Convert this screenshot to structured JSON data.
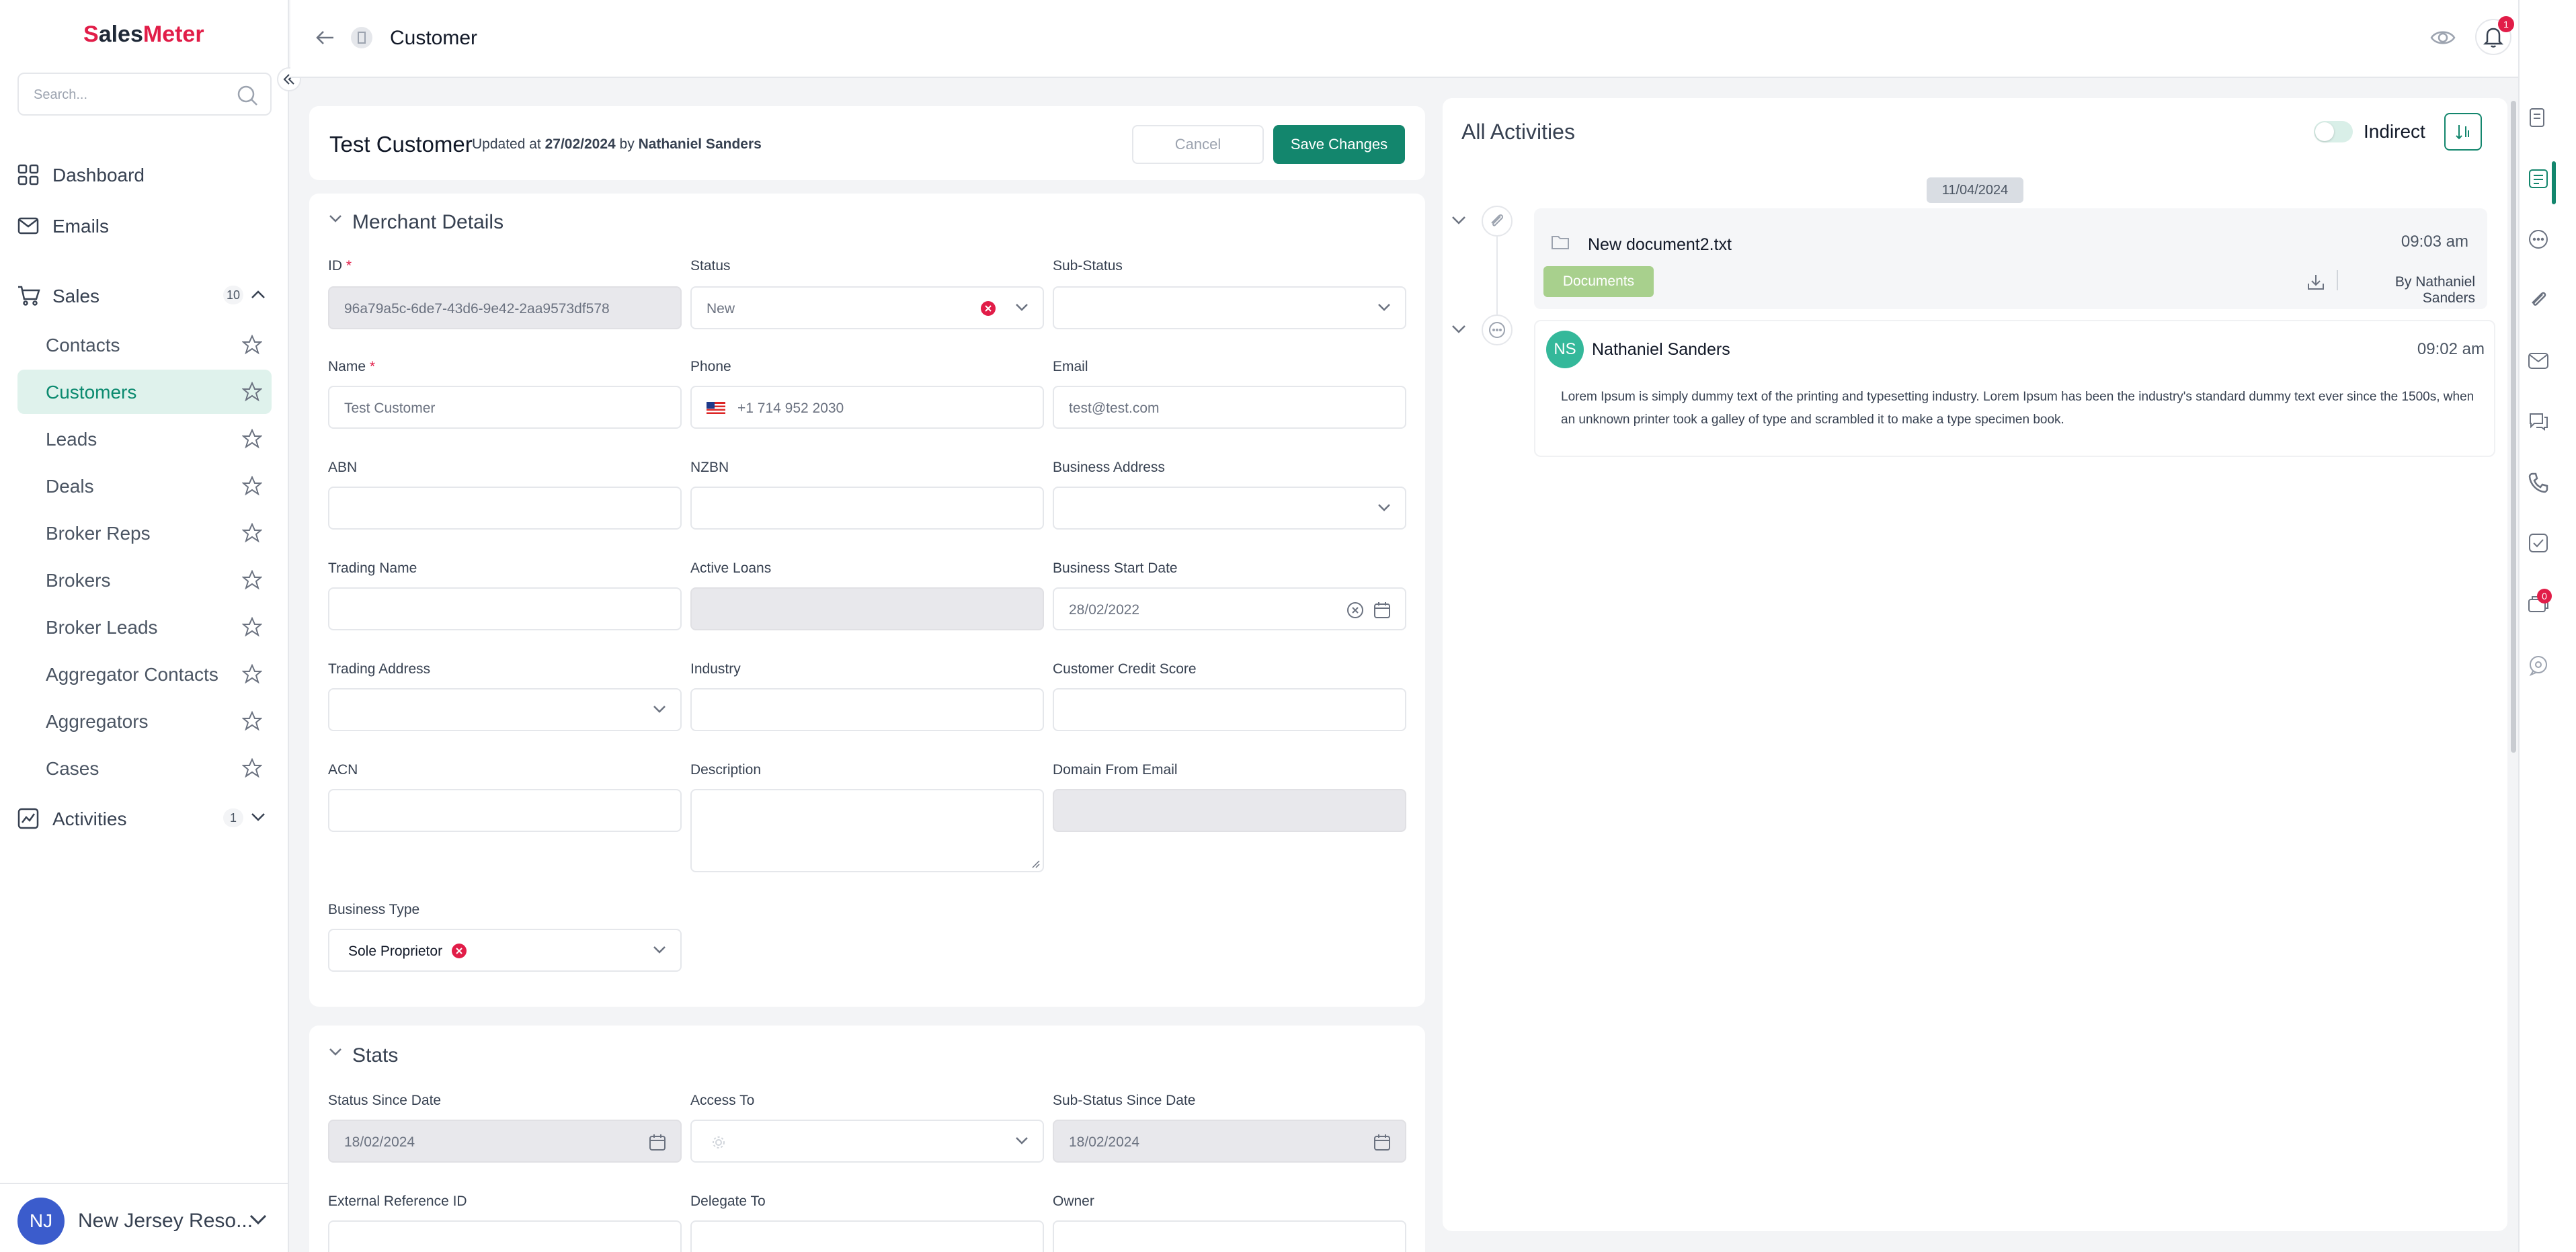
{
  "app": {
    "logo_first": "S",
    "logo_mid": "ales",
    "logo_last": "Meter"
  },
  "sidebar": {
    "search_placeholder": "Search...",
    "nav": {
      "dashboard": "Dashboard",
      "emails": "Emails",
      "sales": "Sales",
      "sales_count": "10",
      "activities": "Activities",
      "activities_count": "1"
    },
    "sales_items": [
      "Contacts",
      "Customers",
      "Leads",
      "Deals",
      "Broker Reps",
      "Brokers",
      "Broker Leads",
      "Aggregator Contacts",
      "Aggregators",
      "Cases"
    ],
    "user": {
      "initials": "NJ",
      "name": "New Jersey Reso..."
    }
  },
  "topbar": {
    "title": "Customer",
    "notification_count": "1"
  },
  "record": {
    "title": "Test Customer",
    "updated_prefix": "Updated at",
    "updated_date": "27/02/2024",
    "by_word": "by",
    "updated_by": "Nathaniel Sanders",
    "cancel_label": "Cancel",
    "save_label": "Save Changes"
  },
  "merchant": {
    "section_title": "Merchant Details",
    "labels": {
      "id": "ID",
      "status": "Status",
      "sub_status": "Sub-Status",
      "name": "Name",
      "phone": "Phone",
      "email": "Email",
      "abn": "ABN",
      "nzbn": "NZBN",
      "business_address": "Business Address",
      "trading_name": "Trading Name",
      "active_loans": "Active Loans",
      "business_start_date": "Business Start Date",
      "trading_address": "Trading Address",
      "industry": "Industry",
      "customer_credit_score": "Customer Credit Score",
      "acn": "ACN",
      "description": "Description",
      "domain_from_email": "Domain From Email",
      "business_type": "Business Type"
    },
    "required_mark": "*",
    "values": {
      "id": "96a79a5c-6de7-43d6-9e42-2aa9573df578",
      "status": "New",
      "name_placeholder": "Test Customer",
      "phone_placeholder": "+1 714 952 2030",
      "email_placeholder": "test@test.com",
      "business_start_date": "28/02/2022",
      "business_type": "Sole Proprietor"
    }
  },
  "stats": {
    "section_title": "Stats",
    "labels": {
      "status_since_date": "Status Since Date",
      "access_to": "Access To",
      "sub_status_since_date": "Sub-Status Since Date",
      "external_reference_id": "External Reference ID",
      "delegate_to": "Delegate To",
      "owner": "Owner"
    },
    "values": {
      "status_since_date": "18/02/2024",
      "sub_status_since_date": "18/02/2024"
    }
  },
  "activities": {
    "title": "All Activities",
    "toggle_label": "Indirect",
    "date": "11/04/2024",
    "items": [
      {
        "title": "New document2.txt",
        "time": "09:03 am",
        "tag": "Documents",
        "by": "By Nathaniel Sanders"
      },
      {
        "initials": "NS",
        "author": "Nathaniel Sanders",
        "time": "09:02 am",
        "body": "Lorem Ipsum is simply dummy text of the printing and typesetting industry. Lorem Ipsum has been the industry's standard dummy text ever since the 1500s, when an unknown printer took a galley of type and scrambled it to make a type specimen book."
      }
    ],
    "rail_badge": "0"
  }
}
